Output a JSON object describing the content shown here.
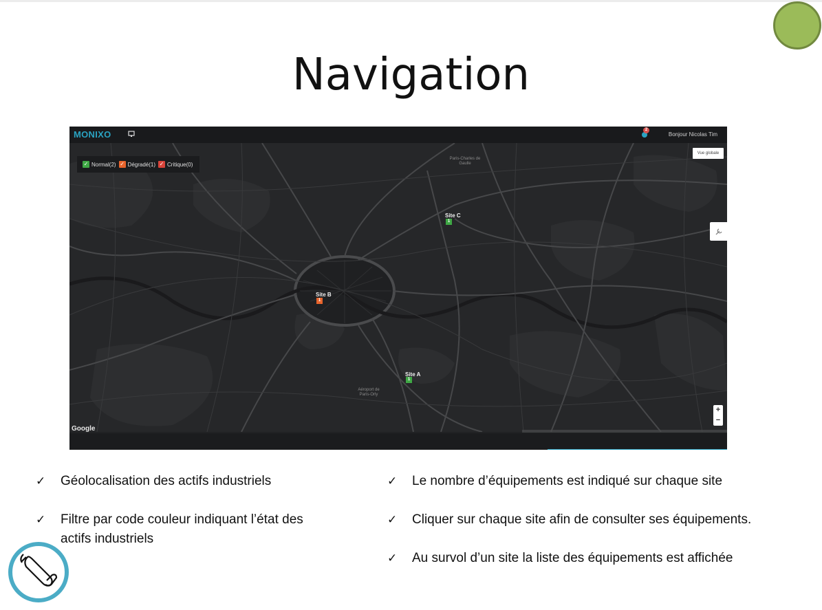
{
  "slide": {
    "title": "Navigation"
  },
  "app": {
    "logo": "MONIXO",
    "notification_count": "2",
    "greeting": "Bonjour Nicolas Tim",
    "global_view_button": "Vue globale",
    "zoom_in": "+",
    "zoom_out": "−",
    "map_provider": "Google"
  },
  "filters": [
    {
      "label": "Normal(2)",
      "color": "#3fa845"
    },
    {
      "label": "Dégradé(1)",
      "color": "#e8642c"
    },
    {
      "label": "Critique(0)",
      "color": "#d9443a"
    }
  ],
  "sites": [
    {
      "label": "Site C",
      "count": "1",
      "color": "#3fa845"
    },
    {
      "label": "Site B",
      "count": "1",
      "color": "#e8642c"
    },
    {
      "label": "Site A",
      "count": "1",
      "color": "#3fa845"
    }
  ],
  "map_labels": {
    "cdg": "Paris-Charles de Gaulle",
    "orly": "Aéroport de Paris-Orly"
  },
  "bullets_left": [
    "Géolocalisation des actifs industriels",
    "Filtre par code couleur indiquant l’état des actifs industriels"
  ],
  "bullets_right": [
    "Le nombre d’équipements est indiqué sur chaque site",
    "Cliquer sur chaque site afin de consulter ses équipements.",
    "Au survol d’un site la liste des équipements est affichée"
  ],
  "check_glyph": "✓",
  "colors": {
    "accent_green": "#9bbb59",
    "accent_blue": "#4bacc6",
    "brand": "#2aa3c2"
  }
}
